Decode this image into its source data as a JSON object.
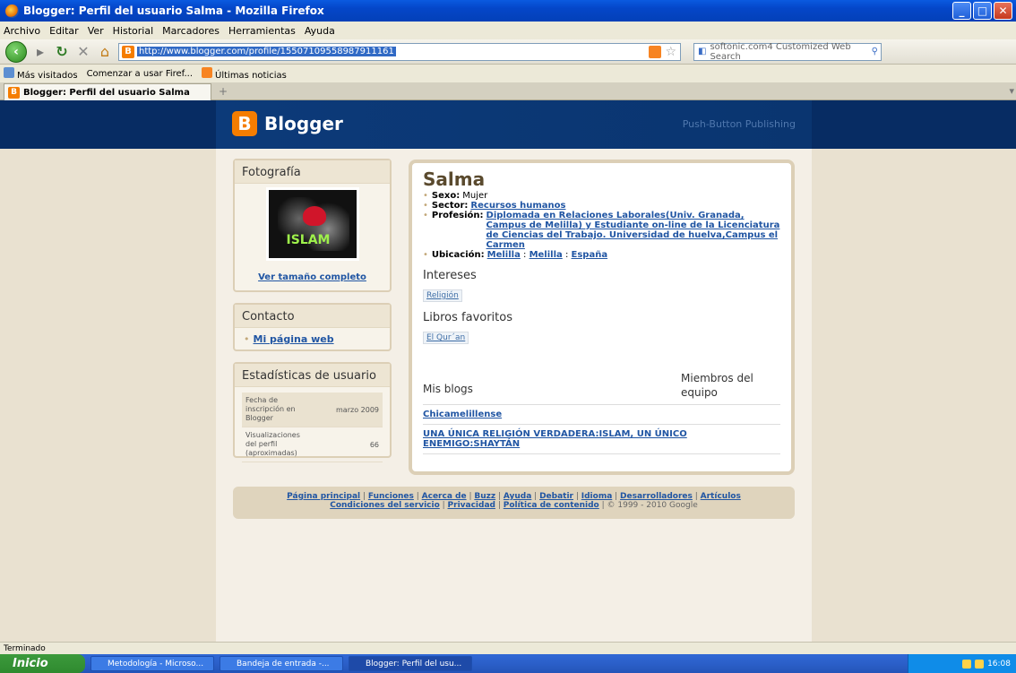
{
  "window": {
    "title": "Blogger: Perfil del usuario Salma - Mozilla Firefox"
  },
  "menu": [
    "Archivo",
    "Editar",
    "Ver",
    "Historial",
    "Marcadores",
    "Herramientas",
    "Ayuda"
  ],
  "nav": {
    "url": "http://www.blogger.com/profile/15507109558987911161",
    "search_placeholder": "softonic.com4 Customized Web Search"
  },
  "bookmarks": [
    "Más visitados",
    "Comenzar a usar Firef...",
    "Últimas noticias"
  ],
  "tab": {
    "label": "Blogger: Perfil del usuario Salma"
  },
  "blogger": {
    "logo": "Blogger",
    "tagline": "Push-Button Publishing"
  },
  "sidebar": {
    "photo_title": "Fotografía",
    "photo_text": "ISLAM",
    "full_size_link": "Ver tamaño completo",
    "contact_title": "Contacto",
    "contact_link": "Mi página web",
    "stats_title": "Estadísticas de usuario",
    "stats": [
      {
        "label": "Fecha de inscripción en Blogger",
        "value": "marzo 2009"
      },
      {
        "label": "Visualizaciones del perfil (aproximadas)",
        "value": "66"
      }
    ]
  },
  "profile": {
    "name": "Salma",
    "sexo_label": "Sexo:",
    "sexo": "Mujer",
    "sector_label": "Sector:",
    "sector": "Recursos humanos",
    "profesion_label": "Profesión:",
    "profesion": "Diplomada en Relaciones Laborales(Univ. Granada, Campus de Melilla) y Estudiante on-line de la Licenciatura de Ciencias del Trabajo. Universidad de huelva,Campus el Carmen",
    "ubicacion_label": "Ubicación:",
    "ubicacion": [
      "Melilla",
      "Melilla",
      "España"
    ],
    "intereses_title": "Intereses",
    "intereses": "Religión",
    "libros_title": "Libros favoritos",
    "libros": "El Qur´an",
    "blogs_title": "Mis blogs",
    "team_title": "Miembros del equipo",
    "blogs": [
      "Chicamelillense",
      "UNA ÚNICA RELIGIÓN VERDADERA:ISLAM, UN ÚNICO ENEMIGO:SHAYTÁN"
    ]
  },
  "footer": {
    "links1": [
      "Página principal",
      "Funciones",
      "Acerca de",
      "Buzz",
      "Ayuda",
      "Debatir",
      "Idioma",
      "Desarrolladores",
      "Artículos"
    ],
    "links2": [
      "Condiciones del servicio",
      "Privacidad",
      "Política de contenido"
    ],
    "copyright": "© 1999 - 2010 Google"
  },
  "status": "Terminado",
  "taskbar": {
    "start": "Inicio",
    "tasks": [
      "Metodología - Microso...",
      "Bandeja de entrada -...",
      "Blogger: Perfil del usu..."
    ],
    "clock": "16:08"
  }
}
